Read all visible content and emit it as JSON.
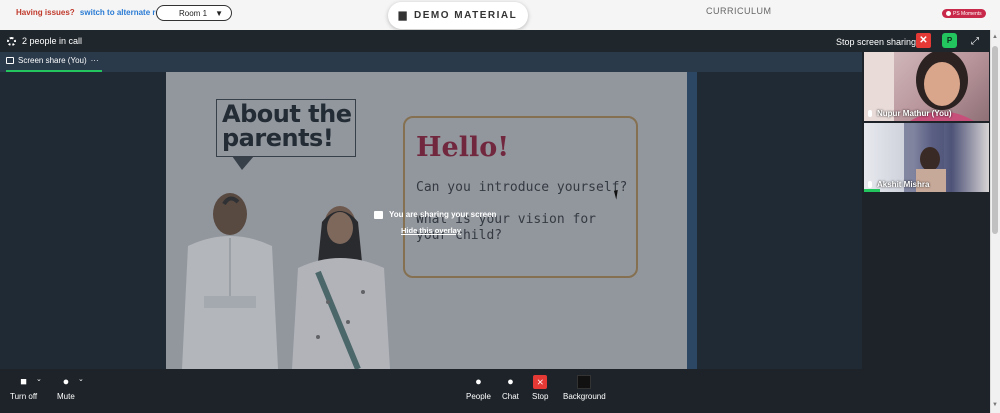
{
  "topbar": {
    "issues_label": "Having issues?",
    "alt_room_link": "switch to alternate room",
    "room_select_value": "Room 1",
    "demo_material_label": "DEMO MATERIAL",
    "curriculum_label": "CURRICULUM",
    "ps_moments_label": "PS Moments"
  },
  "call": {
    "people_count": "2 people in call",
    "stop_sharing_label": "Stop screen sharing",
    "close_glyph": "✕",
    "p_badge": "P",
    "expand_glyph": "⤢"
  },
  "tab": {
    "label": "Screen share (You)",
    "more": "···"
  },
  "slide": {
    "about_line1": "About the",
    "about_line2": "parents!",
    "hello": "Hello!",
    "question1": "Can you introduce yourself?",
    "question2": "What is your vision for your child?"
  },
  "overlay": {
    "sharing_message": "You are sharing your screen",
    "hide_link": "Hide this overlay"
  },
  "participants": [
    {
      "name": "Nupur Mathur (You)"
    },
    {
      "name": "Akshit Mishra"
    }
  ],
  "toolbar": {
    "turn_off": "Turn off",
    "mute": "Mute",
    "people": "People",
    "chat": "Chat",
    "stop": "Stop",
    "background": "Background"
  },
  "icons": {
    "gear": "gear-icon",
    "camera": "video-camera-icon",
    "mic": "microphone-icon",
    "people": "person-icon",
    "chat": "chat-bubble-icon",
    "stop": "stop-share-icon",
    "background": "background-icon"
  },
  "colors": {
    "accent_green": "#22c55e",
    "danger_red": "#e53935",
    "meeting_bg": "#1d2329",
    "hello_color": "#8e2642"
  }
}
